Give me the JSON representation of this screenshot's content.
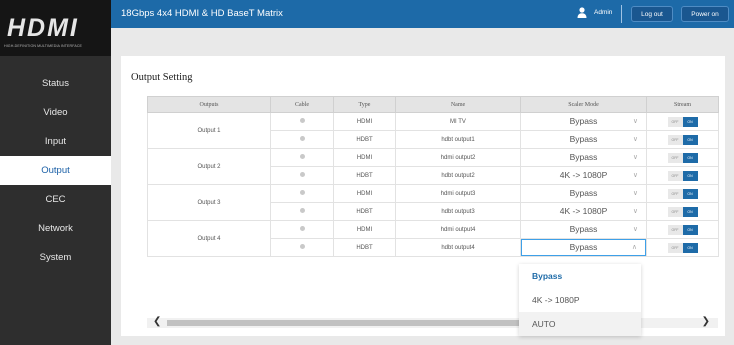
{
  "logo": {
    "text": "HDMI",
    "subtitle": "HIGH-DEFINITION MULTIMEDIA INTERFACE"
  },
  "sidebar": {
    "items": [
      {
        "label": "Status"
      },
      {
        "label": "Video"
      },
      {
        "label": "Input"
      },
      {
        "label": "Output",
        "active": true
      },
      {
        "label": "CEC"
      },
      {
        "label": "Network"
      },
      {
        "label": "System"
      }
    ]
  },
  "header": {
    "title": "18Gbps 4x4 HDMI & HD BaseT Matrix",
    "user": "Admin",
    "logout_label": "Log out",
    "power_label": "Power on"
  },
  "main": {
    "section_title": "Output Setting",
    "columns": [
      "Outputs",
      "Cable",
      "Type",
      "Name",
      "Scaler Mode",
      "Stream"
    ],
    "toggle_off": "OFF",
    "toggle_on": "ON",
    "groups": [
      {
        "label": "Output 1",
        "rows": [
          {
            "type": "HDMI",
            "name": "MI TV",
            "scaler": "Bypass"
          },
          {
            "type": "HDBT",
            "name": "hdbt output1",
            "scaler": "Bypass"
          }
        ]
      },
      {
        "label": "Output 2",
        "rows": [
          {
            "type": "HDMI",
            "name": "hdmi output2",
            "scaler": "Bypass"
          },
          {
            "type": "HDBT",
            "name": "hdbt output2",
            "scaler": "4K -> 1080P"
          }
        ]
      },
      {
        "label": "Output 3",
        "rows": [
          {
            "type": "HDMI",
            "name": "hdmi output3",
            "scaler": "Bypass"
          },
          {
            "type": "HDBT",
            "name": "hdbt output3",
            "scaler": "4K -> 1080P"
          }
        ]
      },
      {
        "label": "Output 4",
        "rows": [
          {
            "type": "HDMI",
            "name": "hdmi output4",
            "scaler": "Bypass"
          },
          {
            "type": "HDBT",
            "name": "hdbt output4",
            "scaler": "Bypass",
            "open": true
          }
        ]
      }
    ],
    "dropdown_options": [
      {
        "label": "Bypass",
        "selected": true
      },
      {
        "label": "4K -> 1080P"
      },
      {
        "label": "AUTO",
        "hover": true
      }
    ]
  },
  "colors": {
    "accent": "#1d6aa8",
    "sidebar": "#2e2e2e",
    "active_text": "#1a5fa6"
  },
  "icons": {
    "user": "user-icon",
    "chevron_down": "chevron-down-icon",
    "chevron_up": "chevron-up-icon"
  }
}
